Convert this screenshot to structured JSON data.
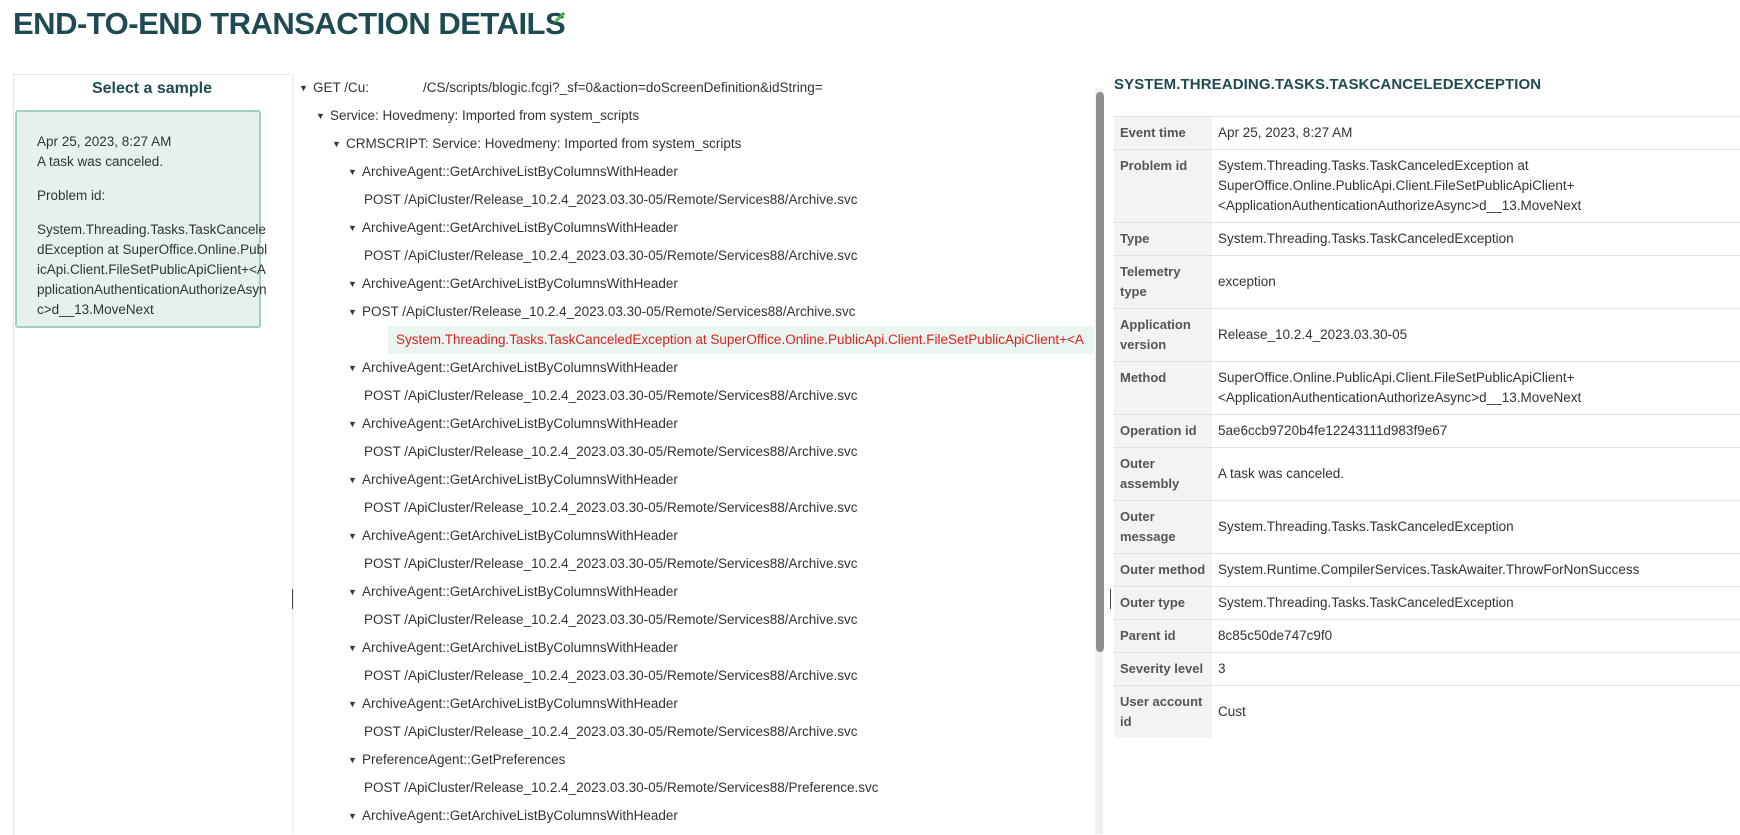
{
  "page": {
    "title": "END-TO-END TRANSACTION DETAILS",
    "edit_icon": "pencil-icon"
  },
  "sample_panel": {
    "heading": "Select a sample",
    "card": {
      "time": "Apr 25, 2023, 8:27 AM",
      "message": "A task was canceled.",
      "problem_label": "Problem id:",
      "problem_value": "System.Threading.Tasks.TaskCanceledException at SuperOffice.Online.PublicApi.Client.FileSetPublicApiClient+<ApplicationAuthenticationAuthorizeAsync>d__13.MoveNext"
    }
  },
  "tree": {
    "root": {
      "part1": "GET /Cu:",
      "part2": "/CS/scripts/blogic.fcgi?_sf=0&action=doScreenDefinition&idString="
    },
    "rows": [
      "Service: Hovedmeny: Imported from system_scripts",
      "CRMSCRIPT: Service: Hovedmeny: Imported from system_scripts",
      "ArchiveAgent::GetArchiveListByColumnsWithHeader",
      "POST /ApiCluster/Release_10.2.4_2023.03.30-05/Remote/Services88/Archive.svc",
      "ArchiveAgent::GetArchiveListByColumnsWithHeader",
      "POST /ApiCluster/Release_10.2.4_2023.03.30-05/Remote/Services88/Archive.svc",
      "ArchiveAgent::GetArchiveListByColumnsWithHeader",
      "POST /ApiCluster/Release_10.2.4_2023.03.30-05/Remote/Services88/Archive.svc",
      "System.Threading.Tasks.TaskCanceledException at SuperOffice.Online.PublicApi.Client.FileSetPublicApiClient+<A",
      "ArchiveAgent::GetArchiveListByColumnsWithHeader",
      "POST /ApiCluster/Release_10.2.4_2023.03.30-05/Remote/Services88/Archive.svc",
      "ArchiveAgent::GetArchiveListByColumnsWithHeader",
      "POST /ApiCluster/Release_10.2.4_2023.03.30-05/Remote/Services88/Archive.svc",
      "ArchiveAgent::GetArchiveListByColumnsWithHeader",
      "POST /ApiCluster/Release_10.2.4_2023.03.30-05/Remote/Services88/Archive.svc",
      "ArchiveAgent::GetArchiveListByColumnsWithHeader",
      "POST /ApiCluster/Release_10.2.4_2023.03.30-05/Remote/Services88/Archive.svc",
      "ArchiveAgent::GetArchiveListByColumnsWithHeader",
      "POST /ApiCluster/Release_10.2.4_2023.03.30-05/Remote/Services88/Archive.svc",
      "ArchiveAgent::GetArchiveListByColumnsWithHeader",
      "POST /ApiCluster/Release_10.2.4_2023.03.30-05/Remote/Services88/Archive.svc",
      "ArchiveAgent::GetArchiveListByColumnsWithHeader",
      "POST /ApiCluster/Release_10.2.4_2023.03.30-05/Remote/Services88/Archive.svc",
      "PreferenceAgent::GetPreferences",
      "POST /ApiCluster/Release_10.2.4_2023.03.30-05/Remote/Services88/Preference.svc",
      "ArchiveAgent::GetArchiveListByColumnsWithHeader"
    ]
  },
  "details": {
    "title": "System.Threading.Tasks.TaskCanceledException",
    "rows": [
      {
        "key": "Event time",
        "value": "Apr 25, 2023, 8:27 AM"
      },
      {
        "key": "Problem id",
        "value": "System.Threading.Tasks.TaskCanceledException at SuperOffice.Online.PublicApi.Client.FileSetPublicApiClient+ <ApplicationAuthenticationAuthorizeAsync>d__13.MoveNext"
      },
      {
        "key": "Type",
        "value": "System.Threading.Tasks.TaskCanceledException"
      },
      {
        "key": "Telemetry type",
        "value": "exception"
      },
      {
        "key": "Application version",
        "value": "Release_10.2.4_2023.03.30-05"
      },
      {
        "key": "Method",
        "value": "SuperOffice.Online.PublicApi.Client.FileSetPublicApiClient+ <ApplicationAuthenticationAuthorizeAsync>d__13.MoveNext"
      },
      {
        "key": "Operation id",
        "value": "5ae6ccb9720b4fe12243111d983f9e67"
      },
      {
        "key": "Outer assembly",
        "value": "A task was canceled."
      },
      {
        "key": "Outer message",
        "value": "System.Threading.Tasks.TaskCanceledException"
      },
      {
        "key": "Outer method",
        "value": "System.Runtime.CompilerServices.TaskAwaiter.ThrowForNonSuccess"
      },
      {
        "key": "Outer type",
        "value": "System.Threading.Tasks.TaskCanceledException"
      },
      {
        "key": "Parent id",
        "value": "8c85c50de747c9f0"
      },
      {
        "key": "Severity level",
        "value": "3"
      },
      {
        "key": "User account id",
        "value": "Cust"
      }
    ]
  },
  "colors": {
    "accent": "#1e4a52",
    "error": "#d9211f",
    "card_bg": "#e4f1ec",
    "card_border": "#9fd1bd"
  }
}
